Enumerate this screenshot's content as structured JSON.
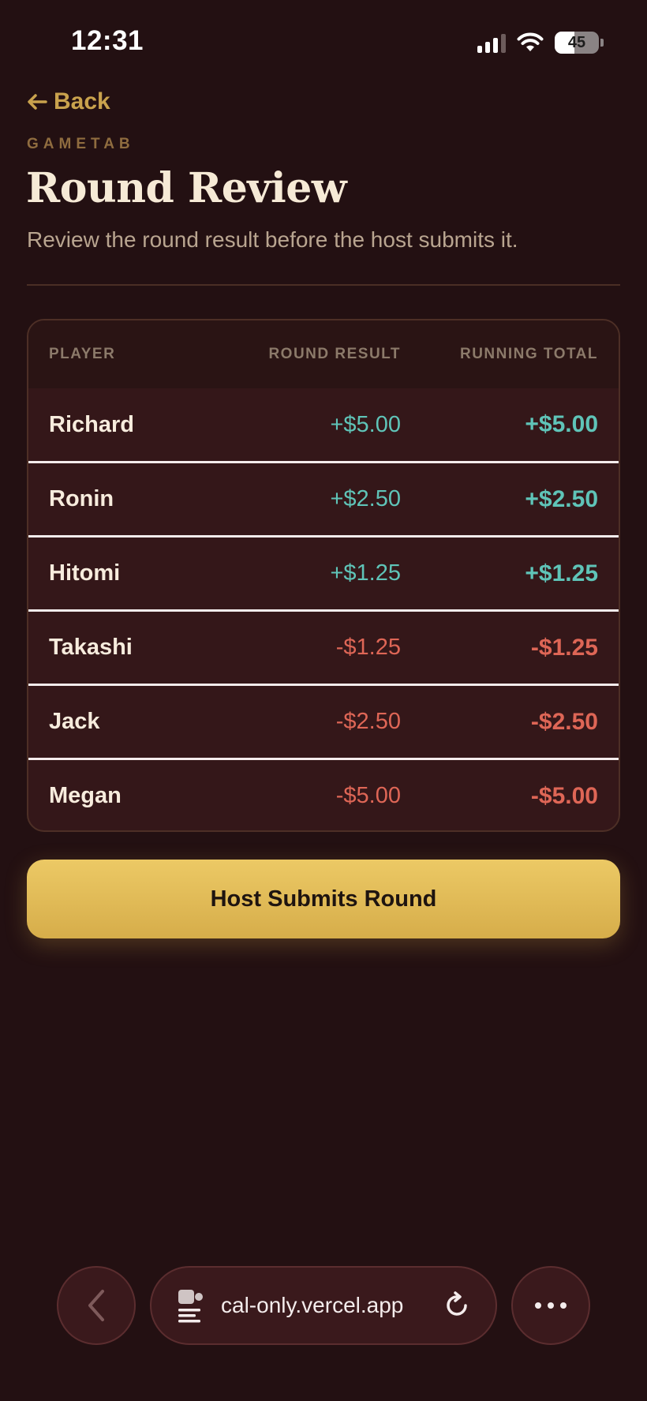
{
  "status_bar": {
    "time": "12:31",
    "battery_level": "45",
    "icons": [
      "signal-icon",
      "wifi-icon",
      "battery-icon"
    ]
  },
  "header": {
    "back_label": "Back",
    "back_icon": "arrow-left-icon",
    "eyebrow": "GAMETAB",
    "title": "Round Review",
    "subtitle": "Review the round result before the host submits it."
  },
  "table": {
    "columns": [
      "PLAYER",
      "ROUND RESULT",
      "RUNNING TOTAL"
    ],
    "rows": [
      {
        "player": "Richard",
        "round_result": "+$5.00",
        "running_total": "+$5.00",
        "sign": "pos"
      },
      {
        "player": "Ronin",
        "round_result": "+$2.50",
        "running_total": "+$2.50",
        "sign": "pos"
      },
      {
        "player": "Hitomi",
        "round_result": "+$1.25",
        "running_total": "+$1.25",
        "sign": "pos"
      },
      {
        "player": "Takashi",
        "round_result": "-$1.25",
        "running_total": "-$1.25",
        "sign": "neg"
      },
      {
        "player": "Jack",
        "round_result": "-$2.50",
        "running_total": "-$2.50",
        "sign": "neg"
      },
      {
        "player": "Megan",
        "round_result": "-$5.00",
        "running_total": "-$5.00",
        "sign": "neg"
      }
    ]
  },
  "actions": {
    "submit_label": "Host Submits Round"
  },
  "browser": {
    "url": "cal-only.vercel.app",
    "icons": [
      "chevron-left-icon",
      "page-settings-icon",
      "reload-icon",
      "more-icon"
    ]
  },
  "colors": {
    "background": "#231012",
    "accent_gold": "#c9a24d",
    "positive": "#5fc4b8",
    "negative": "#de6656",
    "button": "#e4bf5a"
  }
}
